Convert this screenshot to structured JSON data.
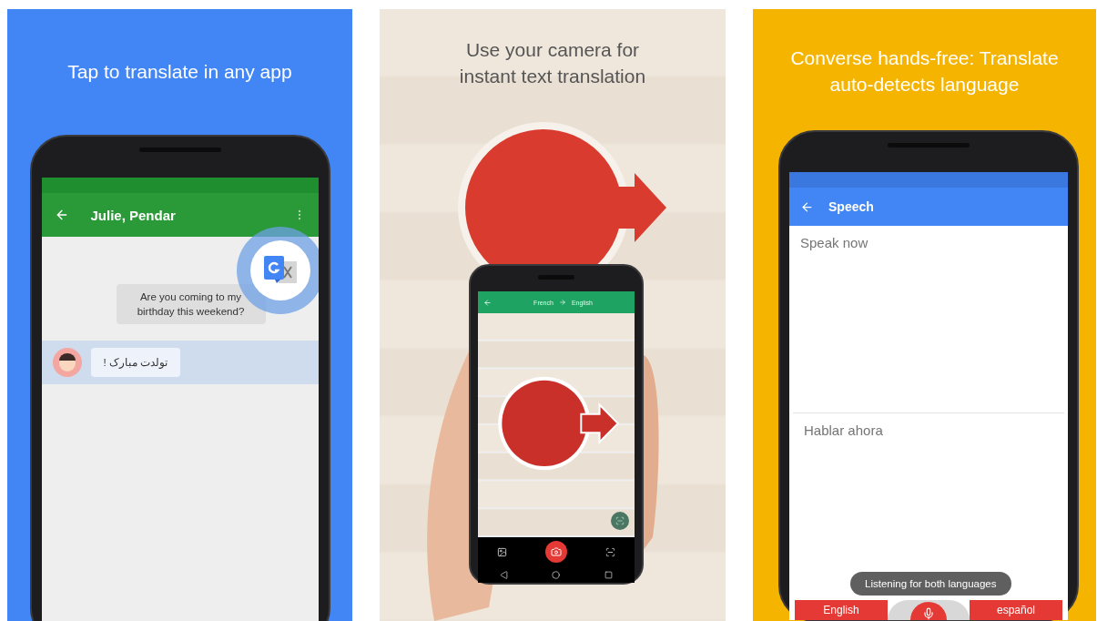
{
  "panels": [
    {
      "kind": "chat",
      "caption_lines": [
        "Tap to translate in any app"
      ],
      "header": {
        "title": "Julie, Pendar"
      },
      "messages": [
        {
          "kind": "plain",
          "text": "Are you coming to my birthday this weekend?",
          "highlighted": false
        },
        {
          "kind": "avatar",
          "text": "تولدت مبارک !",
          "highlighted": true
        }
      ]
    },
    {
      "kind": "camera",
      "caption_lines": [
        "Use your camera for",
        "instant text translation"
      ],
      "source_language": "French",
      "target_language": "English"
    },
    {
      "kind": "speech",
      "caption_lines": [
        "Converse hands-free: Translate",
        "auto-detects language"
      ],
      "header": {
        "title": "Speech"
      },
      "prompts": [
        "Speak now",
        "Hablar ahora"
      ],
      "toast": "Listening for both languages",
      "languages": [
        "English",
        "español"
      ]
    }
  ]
}
